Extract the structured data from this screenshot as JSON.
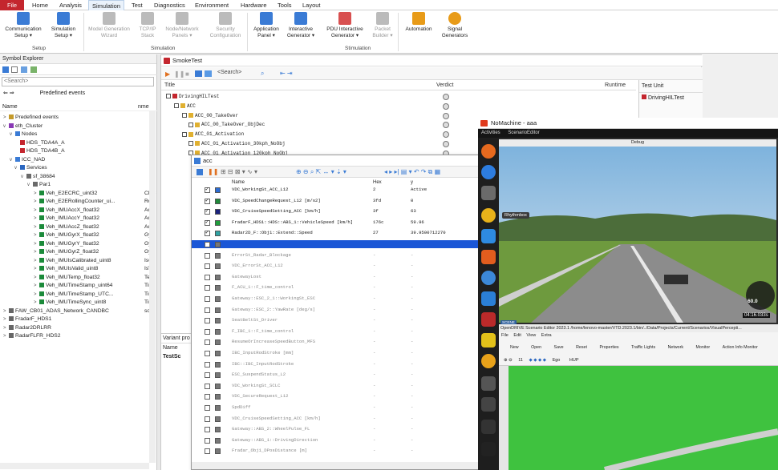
{
  "ribbon": {
    "tabs": [
      "File",
      "Home",
      "Analysis",
      "Simulation",
      "Test",
      "Diagnostics",
      "Environment",
      "Hardware",
      "Tools",
      "Layout"
    ],
    "buttons": [
      {
        "label": "Communication Setup ▾",
        "icon": "network-setup-icon",
        "color": "#3a7bd5"
      },
      {
        "label": "Simulation Setup ▾",
        "icon": "simulation-setup-icon",
        "color": "#3a7bd5"
      },
      {
        "label": "Model Generation Wizard",
        "icon": "wizard-icon",
        "color": "#9a9a9a"
      },
      {
        "label": "TCP/IP Stack",
        "icon": "stack-icon",
        "color": "#9a9a9a"
      },
      {
        "label": "Node/Network Panels ▾",
        "icon": "panels-icon",
        "color": "#9a9a9a"
      },
      {
        "label": "Security Configuration",
        "icon": "security-icon",
        "color": "#9a9a9a"
      },
      {
        "label": "Application Panel ▾",
        "icon": "app-panel-icon",
        "color": "#3a7bd5"
      },
      {
        "label": "Interactive Generator ▾",
        "icon": "ig-icon",
        "color": "#3a7bd5"
      },
      {
        "label": "PDU Interactive Generator ▾",
        "icon": "pdu-ig-icon",
        "color": "#c4262e"
      },
      {
        "label": "Packet Builder ▾",
        "icon": "packet-icon",
        "color": "#9a9a9a"
      },
      {
        "label": "Automation",
        "icon": "automation-icon",
        "color": "#e89b18"
      },
      {
        "label": "Signal Generators",
        "icon": "signal-gen-icon",
        "color": "#e89b18"
      }
    ],
    "groups": [
      "Setup",
      "Simulation",
      "Stimulation"
    ]
  },
  "symbol_explorer": {
    "title": "Symbol Explorer",
    "search_placeholder": "<Search>",
    "filter": "Predefined events",
    "col_name": "Name",
    "col_nme": "nme",
    "items": [
      {
        "label": "Predefined events",
        "suffix": ""
      },
      {
        "label": "eth_Cluster",
        "suffix": ""
      },
      {
        "label": "Nodes",
        "suffix": ""
      },
      {
        "label": "HDS_TDA4A_A",
        "suffix": ""
      },
      {
        "label": "HDS_TDA4B_A",
        "suffix": ""
      },
      {
        "label": "ICC_NAD",
        "suffix": ""
      },
      {
        "label": "Services",
        "suffix": ""
      },
      {
        "label": "sf_38684",
        "suffix": ""
      },
      {
        "label": "Par1",
        "suffix": ""
      },
      {
        "label": "Veh_E2ECRC_uint32",
        "suffix": "CRC"
      },
      {
        "label": "Veh_E2ERollingCounter_ui...",
        "suffix": "Rolli"
      },
      {
        "label": "Veh_IMUAccX_float32",
        "suffix": "Acc"
      },
      {
        "label": "Veh_IMUAccY_float32",
        "suffix": "Acc"
      },
      {
        "label": "Veh_IMUAccZ_float32",
        "suffix": "Acc"
      },
      {
        "label": "Veh_IMUGyrX_float32",
        "suffix": "Gyr"
      },
      {
        "label": "Veh_IMUGyrY_float32",
        "suffix": "Gyr"
      },
      {
        "label": "Veh_IMUGyrZ_float32",
        "suffix": "Gyr"
      },
      {
        "label": "Veh_IMUIsCalibrated_uint8",
        "suffix": "IsCa"
      },
      {
        "label": "Veh_IMUIsValid_uint8",
        "suffix": "IsVa"
      },
      {
        "label": "Veh_IMUTemp_float32",
        "suffix": "Ter"
      },
      {
        "label": "Veh_IMUTimeStamp_uint64",
        "suffix": "Tim"
      },
      {
        "label": "Veh_IMUTimeStamp_UTC...",
        "suffix": "Tim"
      },
      {
        "label": "Veh_IMUTimeSync_uint8",
        "suffix": "Tim"
      },
      {
        "label": "FAW_CB01_ADAS_Network_CANDBC",
        "suffix": "son"
      },
      {
        "label": "FradarF_HDS1",
        "suffix": ""
      },
      {
        "label": "Radar2DRLRR",
        "suffix": ""
      },
      {
        "label": "RadarFLFR_HDS2",
        "suffix": ""
      }
    ]
  },
  "smoketest": {
    "title": "SmokeTest",
    "search_placeholder": "<Search>",
    "col_title": "Title",
    "col_verdict": "Verdict",
    "col_runtime": "Runtime",
    "col_testunit": "Test Unit",
    "testunit_value": "DrivingHILTest",
    "rows": [
      "DrivingHILTest",
      "ACC",
      "ACC_00_TakeOver",
      "ACC_00_TakeOver_ObjDec",
      "ACC_01_Activation",
      "ACC_01_Activation_30kph_NoObj",
      "ACC_01_Activation_120kph_NoObj"
    ],
    "variant_title": "Variant pro",
    "variant_col": "Name",
    "variant_row": "TestSc"
  },
  "acc_window": {
    "title": "acc",
    "col_name": "Name",
    "col_hex": "Hex",
    "col_y": "y",
    "rows": [
      {
        "name": "VDC_WorkingSt_ACC_L12",
        "hex": "2",
        "val": "Active",
        "color": "#2b6cd4",
        "checked": true
      },
      {
        "name": "VDC_SpeedChangeRequest_L12 [m/s2]",
        "hex": "3fd",
        "val": "0",
        "color": "#1f8a3a",
        "checked": true
      },
      {
        "name": "VDC_CruiseSpeedSetting_ACC [km/h]",
        "hex": "3f",
        "val": "63",
        "color": "#1a237e",
        "checked": true
      },
      {
        "name": "FradarF_HDS1::HDS::ABS_1::VehicleSpeed [km/h]",
        "hex": "176c",
        "val": "59.96",
        "color": "#1e9e3c",
        "checked": true
      },
      {
        "name": "Radar2D_F::Obj1::Extend::Speed",
        "hex": "27",
        "val": "39.9500712270",
        "color": "#2fa3a3",
        "checked": true
      },
      {
        "name": "",
        "hex": "",
        "val": "",
        "color": "#777",
        "checked": false
      },
      {
        "name": "ErrorSt_Radar_Blockage",
        "hex": "-",
        "val": "-",
        "color": "#777",
        "checked": false
      },
      {
        "name": "VDC_ErrorSt_ACC_L12",
        "hex": "-",
        "val": "-",
        "color": "#777",
        "checked": false
      },
      {
        "name": "GatewayLost",
        "hex": "-",
        "val": "-",
        "color": "#777",
        "checked": false
      },
      {
        "name": "F_ACU_1::F_time_control",
        "hex": "-",
        "val": "-",
        "color": "#777",
        "checked": false
      },
      {
        "name": "Gateway::ESC_2_1::WorkingSt_ESC",
        "hex": "-",
        "val": "-",
        "color": "#777",
        "checked": false
      },
      {
        "name": "Gateway::ESC_2::YawRate [deg/s]",
        "hex": "-",
        "val": "-",
        "color": "#777",
        "checked": false
      },
      {
        "name": "SeatBeltSt_Driver",
        "hex": "-",
        "val": "-",
        "color": "#777",
        "checked": false
      },
      {
        "name": "F_IBC_1::F_time_control",
        "hex": "-",
        "val": "-",
        "color": "#777",
        "checked": false
      },
      {
        "name": "ResumeOrIncreaseSpeedButton_MFS",
        "hex": "-",
        "val": "-",
        "color": "#777",
        "checked": false
      },
      {
        "name": "IBC_InputRodStroke [mm]",
        "hex": "-",
        "val": "-",
        "color": "#777",
        "checked": false
      },
      {
        "name": "IBC::IBC_InputRodStroke",
        "hex": "-",
        "val": "-",
        "color": "#777",
        "checked": false
      },
      {
        "name": "ESC_SuspendStatus_L2",
        "hex": "-",
        "val": "-",
        "color": "#777",
        "checked": false
      },
      {
        "name": "VDC_WorkingSt_SCLC",
        "hex": "-",
        "val": "-",
        "color": "#777",
        "checked": false
      },
      {
        "name": "VDC_SecureRequest_L12",
        "hex": "-",
        "val": "-",
        "color": "#777",
        "checked": false
      },
      {
        "name": "SpdDiff",
        "hex": "-",
        "val": "-",
        "color": "#777",
        "checked": false
      },
      {
        "name": "VDC_CruiseSpeedSetting_ACC [km/h]",
        "hex": "-",
        "val": "-",
        "color": "#777",
        "checked": false
      },
      {
        "name": "Gateway::ABS_2::WheelPulse_FL",
        "hex": "-",
        "val": "-",
        "color": "#777",
        "checked": false
      },
      {
        "name": "Gateway::ABS_1::DrivingDirection",
        "hex": "-",
        "val": "-",
        "color": "#777",
        "checked": false
      },
      {
        "name": "Fradar_Obj1_DPosDistance [m]",
        "hex": "-",
        "val": "-",
        "color": "#777",
        "checked": false
      }
    ]
  },
  "nomachine": {
    "title": "NoMachine - aaa",
    "activities": "Activities",
    "app_menu": "ScenarioEditor",
    "debug_title": "Debug",
    "tooltip": "Rhythmbox",
    "speed": "60.0",
    "time": "04:16.033s",
    "editor_title": "OpenDRIVE Scenario Editor 2023.1   /home/lenovo-master/VTD.2023.1/bin/../Data/Projects/Current/Scenarios/VisualPercepti...",
    "menu": [
      "File",
      "Edit",
      "View",
      "Extra"
    ],
    "toolbar": [
      "New",
      "Open",
      "Save",
      "Reset",
      "Properties",
      "Traffic Lights",
      "Network",
      "Monitor",
      "Action Info Monitor"
    ],
    "zoom_value": "11",
    "ego": "Ego",
    "hup": "HUP",
    "scene_lbl": "SCENE"
  }
}
